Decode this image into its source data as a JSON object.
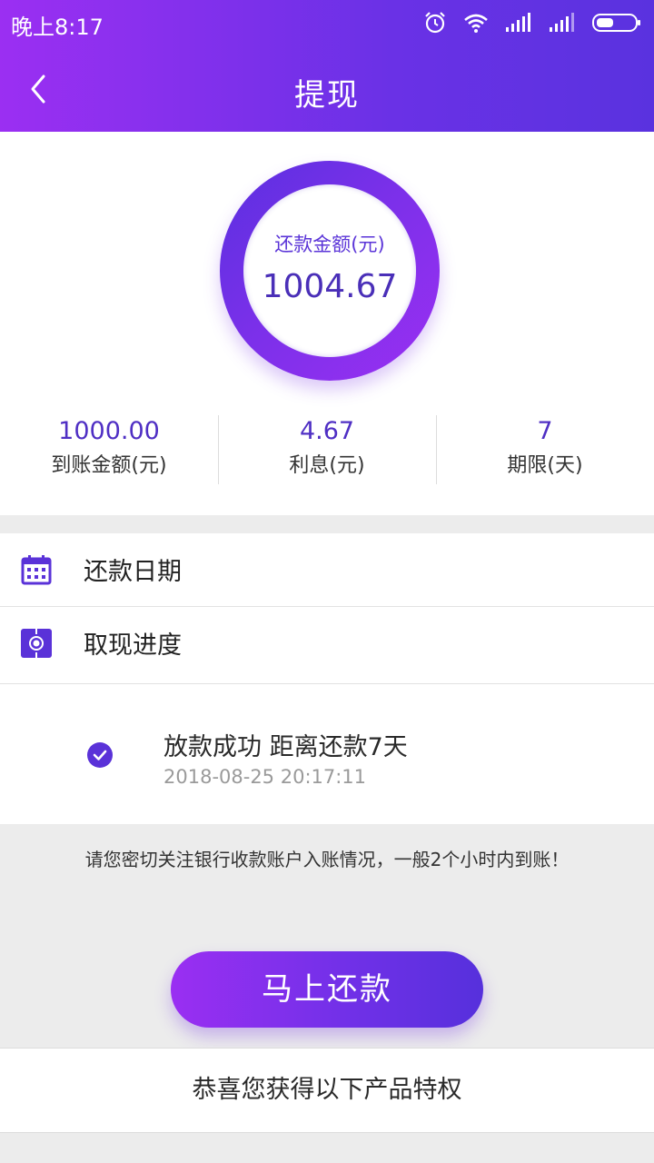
{
  "status_bar": {
    "time": "晚上8:17"
  },
  "nav": {
    "title": "提现"
  },
  "summary": {
    "ring_label": "还款金额(元)",
    "ring_value": "1004.67",
    "stats": [
      {
        "value": "1000.00",
        "label": "到账金额(元)"
      },
      {
        "value": "4.67",
        "label": "利息(元)"
      },
      {
        "value": "7",
        "label": "期限(天)"
      }
    ]
  },
  "rows": {
    "repay_date": "还款日期",
    "progress": "取现进度"
  },
  "timeline": {
    "title": "放款成功 距离还款7天",
    "time": "2018-08-25 20:17:11"
  },
  "notice": "请您密切关注银行收款账户入账情况，一般2个小时内到账！",
  "repay_button": "马上还款",
  "privilege": "恭喜您获得以下产品特权",
  "colors": {
    "accent": "#6a31e6",
    "accent_light": "#9b2ff2"
  }
}
